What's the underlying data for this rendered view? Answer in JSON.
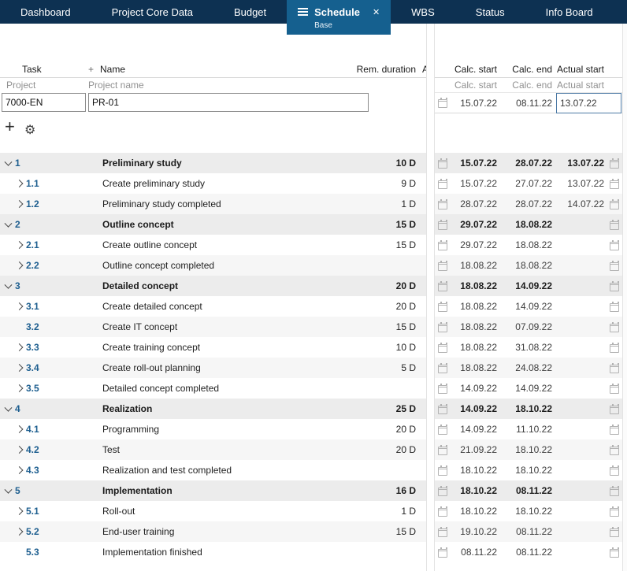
{
  "colors": {
    "tab_bar": "#0d3152",
    "tab_active": "#15608f",
    "accent_blue": "#1d5e8f",
    "band_parent": "#ececec",
    "band_alt": "#f6f6f6",
    "input_border": "#8a8a8a",
    "focus_border": "#4d7aa5"
  },
  "tabs": {
    "close_glyph": "✕",
    "items": [
      {
        "label": "Dashboard",
        "active": false
      },
      {
        "label": "Project Core Data",
        "active": false
      },
      {
        "label": "Budget",
        "active": false
      },
      {
        "label": "Schedule",
        "active": true,
        "sublabel": "Base"
      },
      {
        "label": "WBS",
        "active": false
      },
      {
        "label": "Status",
        "active": false
      },
      {
        "label": "Info Board",
        "active": false
      }
    ]
  },
  "table": {
    "header": {
      "task": "Task",
      "add": "+",
      "name": "Name",
      "rem_duration": "Rem. duration",
      "actual_col": "A",
      "calc_start": "Calc. start",
      "calc_end": "Calc. end",
      "actual_start": "Actual start"
    },
    "subheader": {
      "project": "Project",
      "project_name": "Project name",
      "calc_start": "Calc. start",
      "calc_end": "Calc. end",
      "actual_start": "Actual start"
    },
    "project_row": {
      "id": "7000-EN",
      "name": "PR-01",
      "calc_start": "15.07.22",
      "calc_end": "08.11.22",
      "actual_start": "13.07.22"
    }
  },
  "toolbar": {
    "add": "+",
    "gear": "⚙"
  },
  "tasks": [
    {
      "num": "1",
      "name": "Preliminary study",
      "duration": "10 D",
      "calc_start": "15.07.22",
      "calc_end": "28.07.22",
      "actual_start": "13.07.22",
      "level": 0,
      "chevron": "down",
      "bold": true,
      "band": "parent"
    },
    {
      "num": "1.1",
      "name": "Create preliminary study",
      "duration": "9 D",
      "calc_start": "15.07.22",
      "calc_end": "27.07.22",
      "actual_start": "13.07.22",
      "level": 1,
      "chevron": "right",
      "bold": false,
      "band": "white"
    },
    {
      "num": "1.2",
      "name": "Preliminary study completed",
      "duration": "1 D",
      "calc_start": "28.07.22",
      "calc_end": "28.07.22",
      "actual_start": "14.07.22",
      "level": 1,
      "chevron": "right",
      "bold": false,
      "band": "alt"
    },
    {
      "num": "2",
      "name": "Outline concept",
      "duration": "15 D",
      "calc_start": "29.07.22",
      "calc_end": "18.08.22",
      "actual_start": "",
      "level": 0,
      "chevron": "down",
      "bold": true,
      "band": "parent"
    },
    {
      "num": "2.1",
      "name": "Create outline concept",
      "duration": "15 D",
      "calc_start": "29.07.22",
      "calc_end": "18.08.22",
      "actual_start": "",
      "level": 1,
      "chevron": "right",
      "bold": false,
      "band": "white"
    },
    {
      "num": "2.2",
      "name": "Outline concept completed",
      "duration": "",
      "calc_start": "18.08.22",
      "calc_end": "18.08.22",
      "actual_start": "",
      "level": 1,
      "chevron": "right",
      "bold": false,
      "band": "alt"
    },
    {
      "num": "3",
      "name": "Detailed concept",
      "duration": "20 D",
      "calc_start": "18.08.22",
      "calc_end": "14.09.22",
      "actual_start": "",
      "level": 0,
      "chevron": "down",
      "bold": true,
      "band": "parent"
    },
    {
      "num": "3.1",
      "name": "Create detailed concept",
      "duration": "20 D",
      "calc_start": "18.08.22",
      "calc_end": "14.09.22",
      "actual_start": "",
      "level": 1,
      "chevron": "right",
      "bold": false,
      "band": "white"
    },
    {
      "num": "3.2",
      "name": "Create IT concept",
      "duration": "15 D",
      "calc_start": "18.08.22",
      "calc_end": "07.09.22",
      "actual_start": "",
      "level": 1,
      "chevron": "none",
      "bold": false,
      "band": "alt"
    },
    {
      "num": "3.3",
      "name": "Create training concept",
      "duration": "10 D",
      "calc_start": "18.08.22",
      "calc_end": "31.08.22",
      "actual_start": "",
      "level": 1,
      "chevron": "right",
      "bold": false,
      "band": "white"
    },
    {
      "num": "3.4",
      "name": "Create roll-out planning",
      "duration": "5 D",
      "calc_start": "18.08.22",
      "calc_end": "24.08.22",
      "actual_start": "",
      "level": 1,
      "chevron": "right",
      "bold": false,
      "band": "alt"
    },
    {
      "num": "3.5",
      "name": "Detailed concept completed",
      "duration": "",
      "calc_start": "14.09.22",
      "calc_end": "14.09.22",
      "actual_start": "",
      "level": 1,
      "chevron": "right",
      "bold": false,
      "band": "white"
    },
    {
      "num": "4",
      "name": "Realization",
      "duration": "25 D",
      "calc_start": "14.09.22",
      "calc_end": "18.10.22",
      "actual_start": "",
      "level": 0,
      "chevron": "down",
      "bold": true,
      "band": "parent"
    },
    {
      "num": "4.1",
      "name": "Programming",
      "duration": "20 D",
      "calc_start": "14.09.22",
      "calc_end": "11.10.22",
      "actual_start": "",
      "level": 1,
      "chevron": "right",
      "bold": false,
      "band": "white"
    },
    {
      "num": "4.2",
      "name": "Test",
      "duration": "20 D",
      "calc_start": "21.09.22",
      "calc_end": "18.10.22",
      "actual_start": "",
      "level": 1,
      "chevron": "right",
      "bold": false,
      "band": "alt"
    },
    {
      "num": "4.3",
      "name": "Realization and test completed",
      "duration": "",
      "calc_start": "18.10.22",
      "calc_end": "18.10.22",
      "actual_start": "",
      "level": 1,
      "chevron": "right",
      "bold": false,
      "band": "white"
    },
    {
      "num": "5",
      "name": "Implementation",
      "duration": "16 D",
      "calc_start": "18.10.22",
      "calc_end": "08.11.22",
      "actual_start": "",
      "level": 0,
      "chevron": "down",
      "bold": true,
      "band": "parent"
    },
    {
      "num": "5.1",
      "name": "Roll-out",
      "duration": "1 D",
      "calc_start": "18.10.22",
      "calc_end": "18.10.22",
      "actual_start": "",
      "level": 1,
      "chevron": "right",
      "bold": false,
      "band": "white"
    },
    {
      "num": "5.2",
      "name": "End-user training",
      "duration": "15 D",
      "calc_start": "19.10.22",
      "calc_end": "08.11.22",
      "actual_start": "",
      "level": 1,
      "chevron": "right",
      "bold": false,
      "band": "alt"
    },
    {
      "num": "5.3",
      "name": "Implementation finished",
      "duration": "",
      "calc_start": "08.11.22",
      "calc_end": "08.11.22",
      "actual_start": "",
      "level": 1,
      "chevron": "none",
      "bold": false,
      "band": "white"
    }
  ]
}
